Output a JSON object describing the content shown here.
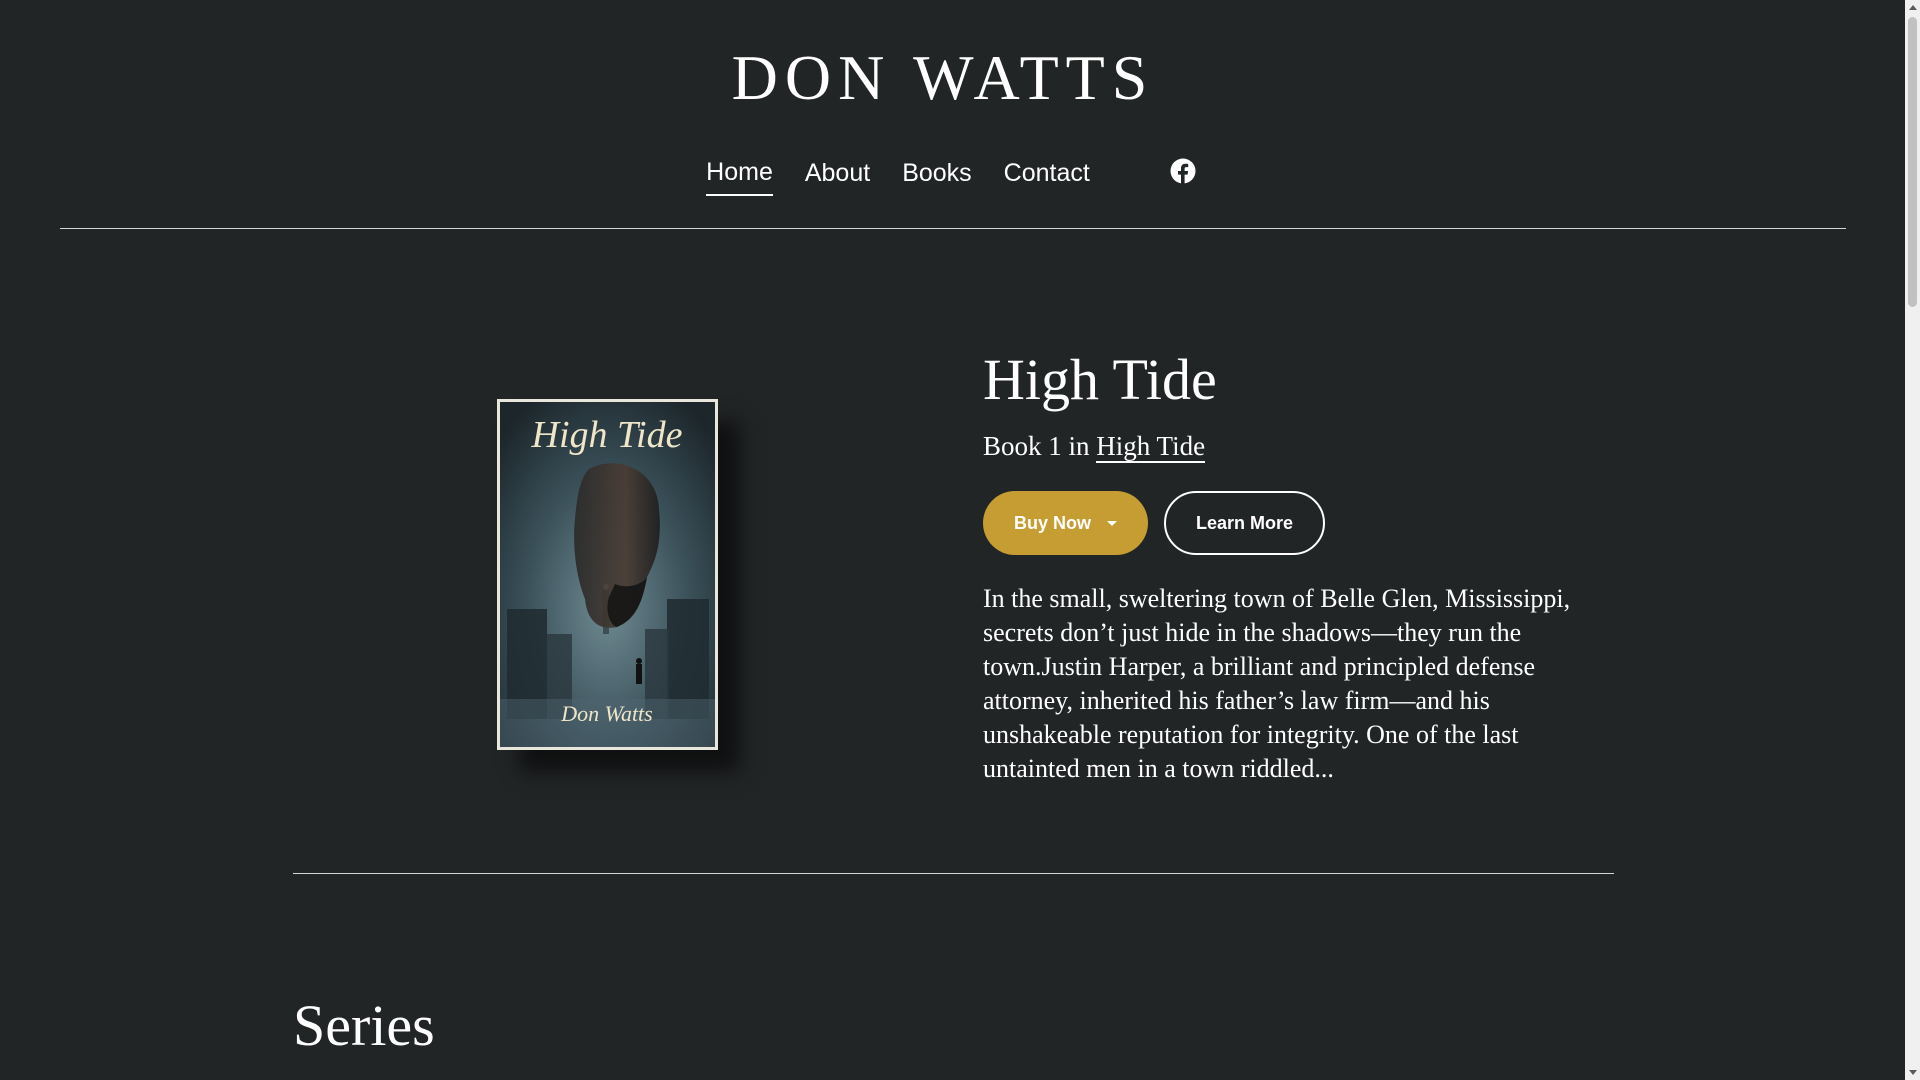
{
  "site": {
    "title": "DON WATTS"
  },
  "nav": {
    "items": [
      {
        "label": "Home",
        "active": true
      },
      {
        "label": "About",
        "active": false
      },
      {
        "label": "Books",
        "active": false
      },
      {
        "label": "Contact",
        "active": false
      }
    ],
    "social_icon": "facebook-icon"
  },
  "book": {
    "title": "High Tide",
    "series_prefix": "Book 1 in",
    "series_name": "High Tide",
    "buy_label": "Buy Now",
    "learn_label": "Learn More",
    "blurb": "In the small, sweltering town of Belle Glen, Mississippi, secrets don’t just hide in the shadows—they run the town.Justin Harper, a brilliant and principled defense attorney, inherited his father’s law firm—and his unshakeable reputation for integrity. One of the last untainted men in a town riddled...",
    "cover": {
      "title": "High Tide",
      "author": "Don Watts"
    }
  },
  "series_section": {
    "heading": "Series"
  },
  "colors": {
    "background": "#222526",
    "accent": "#c69d33",
    "text": "#ffffff"
  }
}
